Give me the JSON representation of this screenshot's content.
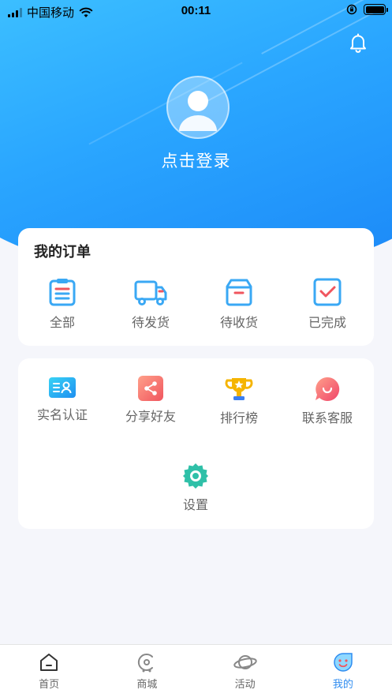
{
  "status_bar": {
    "carrier": "中国移动",
    "time": "00:11"
  },
  "header": {
    "notification_icon": "bell-icon",
    "avatar_icon": "user-avatar-icon",
    "login_label": "点击登录"
  },
  "orders": {
    "title": "我的订单",
    "items": [
      {
        "label": "全部",
        "icon": "clipboard-list-icon"
      },
      {
        "label": "待发货",
        "icon": "delivery-truck-icon"
      },
      {
        "label": "待收货",
        "icon": "package-box-icon"
      },
      {
        "label": "已完成",
        "icon": "checkbox-done-icon"
      }
    ]
  },
  "services": {
    "items": [
      {
        "label": "实名认证",
        "icon": "id-card-icon"
      },
      {
        "label": "分享好友",
        "icon": "share-icon"
      },
      {
        "label": "排行榜",
        "icon": "trophy-icon"
      },
      {
        "label": "联系客服",
        "icon": "chat-bubble-icon"
      },
      {
        "label": "设置",
        "icon": "gear-icon"
      }
    ]
  },
  "tabbar": {
    "items": [
      {
        "label": "首页",
        "icon": "home-icon"
      },
      {
        "label": "商城",
        "icon": "mall-icon"
      },
      {
        "label": "活动",
        "icon": "planet-icon"
      },
      {
        "label": "我的",
        "icon": "smile-face-icon",
        "active": true
      }
    ]
  },
  "colors": {
    "primary_blue": "#2aa6ff",
    "active_tab": "#2e8cf0",
    "accent_red": "#f0555e"
  }
}
